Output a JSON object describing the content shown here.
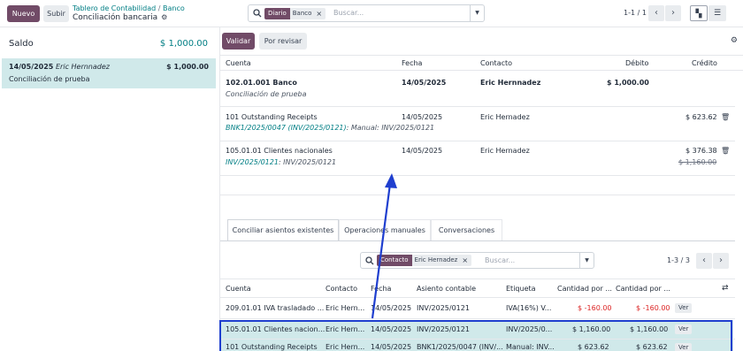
{
  "topbar": {
    "new_label": "Nuevo",
    "upload_label": "Subir",
    "breadcrumb": [
      "Tablero de Contabilidad",
      "Banco"
    ],
    "breadcrumb_sep": "/",
    "subtitle": "Conciliación bancaria",
    "search": {
      "facet_key": "Diario",
      "facet_value": "Banco",
      "placeholder": "Buscar..."
    },
    "pager": "1-1 / 1"
  },
  "left": {
    "saldo_label": "Saldo",
    "saldo_value": "$ 1,000.00",
    "line": {
      "date": "14/05/2025",
      "partner": "Eric Hernnadez",
      "amount": "$ 1,000.00",
      "label": "Conciliación de prueba"
    }
  },
  "right": {
    "validate_label": "Validar",
    "review_label": "Por revisar",
    "columns": {
      "cuenta": "Cuenta",
      "fecha": "Fecha",
      "contacto": "Contacto",
      "debito": "Débito",
      "credito": "Crédito"
    },
    "rows": [
      {
        "account": "102.01.001 Banco",
        "sub": "Conciliación de prueba",
        "date": "14/05/2025",
        "partner": "Eric Hernnadez",
        "debit": "$ 1,000.00",
        "credit": ""
      },
      {
        "account": "101 Outstanding Receipts",
        "sub_link": "BNK1/2025/0047 (INV/2025/0121)",
        "sub_rest": ": Manual: INV/2025/0121",
        "date": "14/05/2025",
        "partner": "Eric Hernadez",
        "debit": "",
        "credit": "$ 623.62"
      },
      {
        "account": "105.01.01 Clientes nacionales",
        "sub_link": "INV/2025/0121",
        "sub_rest": ": INV/2025/0121",
        "date": "14/05/2025",
        "partner": "Eric Hernadez",
        "debit": "",
        "credit": "$ 376.38",
        "credit_old": "$ 1,160.00"
      }
    ],
    "tabs": [
      "Conciliar asientos existentes",
      "Operaciones manuales",
      "Conversaciones"
    ],
    "search2": {
      "facet_key": "Contacto",
      "facet_value": "Eric Hernadez",
      "placeholder": "Buscar..."
    },
    "pager2": "1-3 / 3",
    "columns2": [
      "Cuenta",
      "Contacto",
      "Fecha",
      "Asiento contable",
      "Etiqueta",
      "Cantidad por ...",
      "Cantidad por ..."
    ],
    "rows2": [
      [
        "209.01.01 IVA trasladado ...",
        "Eric Hern...",
        "14/05/2025",
        "INV/2025/0121",
        "IVA(16%) V...",
        "$ -160.00",
        "$ -160.00",
        "Ver"
      ],
      [
        "105.01.01 Clientes nacion...",
        "Eric Hern...",
        "14/05/2025",
        "INV/2025/0121",
        "INV/2025/0...",
        "$ 1,160.00",
        "$ 1,160.00",
        "Ver"
      ],
      [
        "101 Outstanding Receipts",
        "Eric Hern...",
        "14/05/2025",
        "BNK1/2025/0047 (INV/...",
        "Manual: INV...",
        "$ 623.62",
        "$ 623.62",
        "Ver"
      ]
    ]
  },
  "colors": {
    "brand": "#714B67",
    "teal": "#017e84",
    "selected": "#d0e9ea",
    "annotation": "#1f3fcf"
  }
}
